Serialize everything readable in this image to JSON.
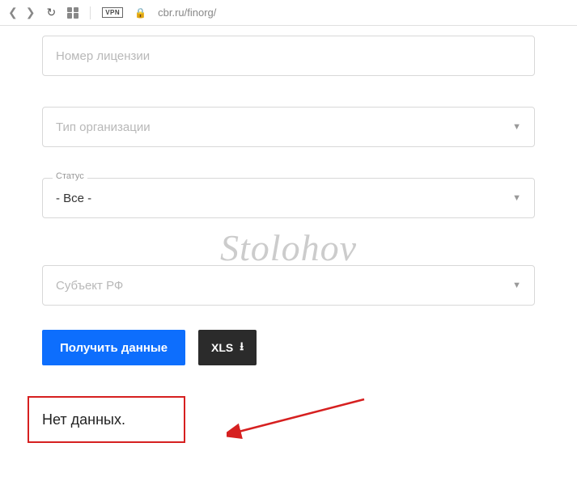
{
  "browser": {
    "url": "cbr.ru/finorg/",
    "vpn": "VPN"
  },
  "form": {
    "license": {
      "placeholder": "Номер лицензии",
      "value": ""
    },
    "orgType": {
      "placeholder": "Тип организации"
    },
    "status": {
      "label": "Статус",
      "value": "- Все -"
    },
    "subject": {
      "placeholder": "Субъект РФ"
    }
  },
  "actions": {
    "submit": "Получить данные",
    "export": "XLS"
  },
  "result": "Нет данных.",
  "watermark": "Stolohov"
}
